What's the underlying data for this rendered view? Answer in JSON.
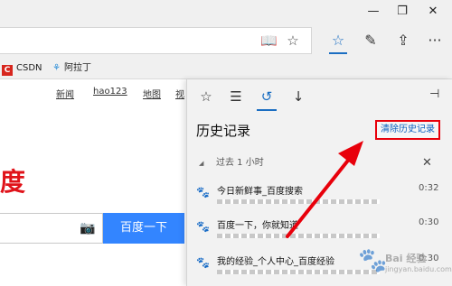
{
  "window": {
    "minimize_icon": "minimize-icon",
    "restore_icon": "restore-icon",
    "close_icon": "close-icon",
    "min_glyph": "—",
    "restore_glyph": "❐",
    "close_glyph": "✕"
  },
  "toolbar": {
    "reading_view_glyph": "📖",
    "favorite_star_glyph": "☆",
    "hub_glyph": "☆",
    "notes_glyph": "✎",
    "share_glyph": "⇪",
    "more_glyph": "···"
  },
  "favorites": {
    "items": [
      {
        "label": "CSDN",
        "logo": "C"
      },
      {
        "label": "阿拉丁",
        "logo": "⚘"
      }
    ]
  },
  "page": {
    "links": [
      "新闻",
      "hao123",
      "地图",
      "视"
    ],
    "brand_text": "度",
    "search_button": "百度一下",
    "camera_glyph": "📷"
  },
  "hub": {
    "tabs": [
      {
        "name": "favorites",
        "glyph": "☆"
      },
      {
        "name": "reading-list",
        "glyph": "☰"
      },
      {
        "name": "history",
        "glyph": "↺"
      },
      {
        "name": "downloads",
        "glyph": "↓"
      }
    ],
    "pin_glyph": "⊣",
    "title": "历史记录",
    "clear_label": "清除历史记录",
    "group": {
      "caret": "◢",
      "label": "过去 1 小时",
      "close": "✕"
    },
    "items": [
      {
        "title": "今日新鲜事_百度搜索",
        "time": "0:32"
      },
      {
        "title": "百度一下，你就知道",
        "time": "0:30"
      },
      {
        "title": "我的经验_个人中心_百度经验",
        "time": "0:30"
      }
    ]
  },
  "watermark": {
    "text": "Bai 经验",
    "url": "jingyan.baidu.com"
  },
  "colors": {
    "accent": "#1b6ec2",
    "annotation": "#e8000b",
    "baidu_blue": "#3385ff",
    "baidu_red": "#e0131a"
  }
}
